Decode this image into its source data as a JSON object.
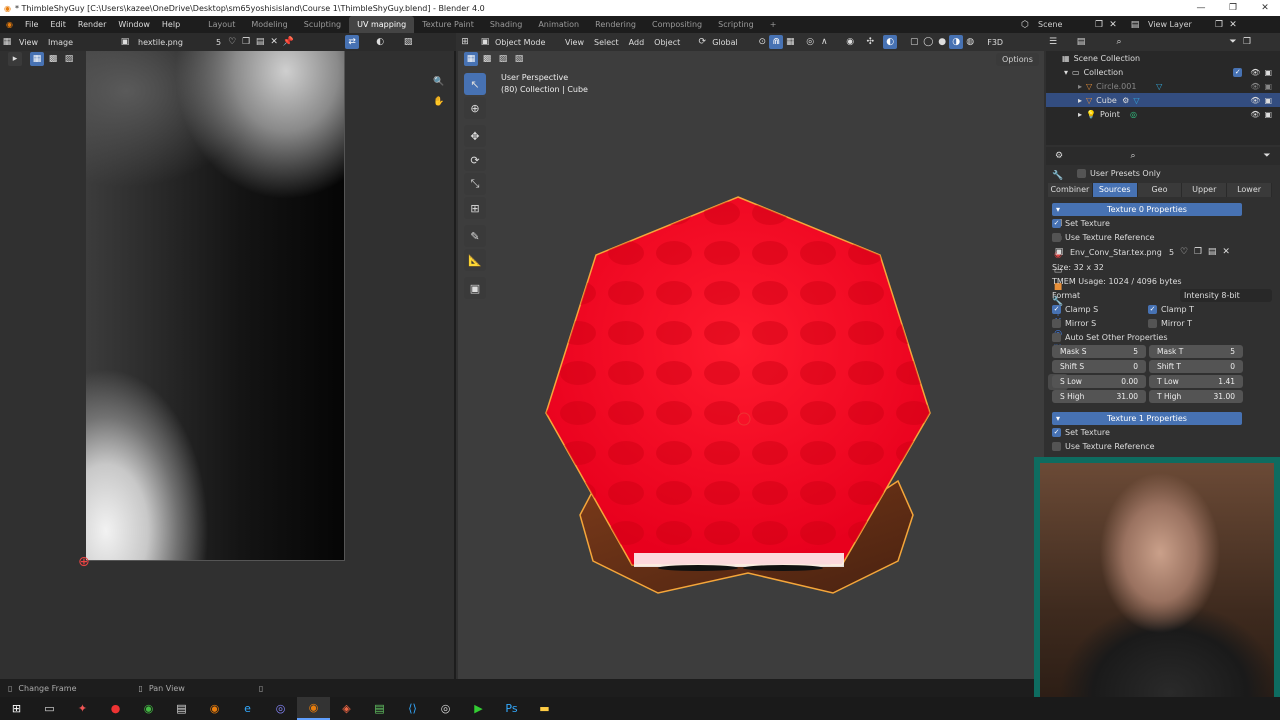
{
  "window": {
    "title": "* ThimbleShyGuy [C:\\Users\\kazee\\OneDrive\\Desktop\\sm65yoshisisland\\Course 1\\ThimbleShyGuy.blend] - Blender 4.0"
  },
  "menu": {
    "items": [
      "File",
      "Edit",
      "Render",
      "Window",
      "Help"
    ]
  },
  "workspaces": [
    "Layout",
    "Modeling",
    "Sculpting",
    "UV mapping",
    "Texture Paint",
    "Shading",
    "Animation",
    "Rendering",
    "Compositing",
    "Scripting",
    "+"
  ],
  "scene": {
    "name": "Scene",
    "view_layer": "View Layer"
  },
  "image_editor": {
    "view": "View",
    "image": "Image",
    "file": "hextile.png",
    "users": "5"
  },
  "viewport": {
    "mode": "Object Mode",
    "menus": [
      "View",
      "Select",
      "Add",
      "Object"
    ],
    "orientation": "Global",
    "options": "Options",
    "perspective": "User Perspective",
    "collection_line": "(80) Collection | Cube",
    "fsd": "F3D",
    "colors": {
      "accent": "#4772b3",
      "object": "#e8001d",
      "outline": "#f5a63a"
    }
  },
  "outliner": {
    "root": "Scene Collection",
    "collection": "Collection",
    "items": [
      "Circle.001",
      "Cube",
      "Point"
    ]
  },
  "props": {
    "user_presets": "User Presets Only",
    "tabs": [
      "Combiner",
      "Sources",
      "Geo",
      "Upper",
      "Lower"
    ],
    "tex0": "Texture 0 Properties",
    "set_texture": "Set Texture",
    "use_ref": "Use Texture Reference",
    "image": "Env_Conv_Star.tex.png",
    "image_users": "5",
    "size": "Size: 32 x 32",
    "tmem": "TMEM Usage: 1024 / 4096 bytes",
    "format_label": "Format",
    "format_val": "Intensity 8-bit",
    "clamp_s": "Clamp S",
    "clamp_t": "Clamp T",
    "mirror_s": "Mirror S",
    "mirror_t": "Mirror T",
    "auto_set": "Auto Set Other Properties",
    "fields": [
      {
        "l": "Mask S",
        "v": "5"
      },
      {
        "l": "Mask T",
        "v": "5"
      },
      {
        "l": "Shift S",
        "v": "0"
      },
      {
        "l": "Shift T",
        "v": "0"
      },
      {
        "l": "S Low",
        "v": "0.00"
      },
      {
        "l": "T Low",
        "v": "1.41"
      },
      {
        "l": "S High",
        "v": "31.00"
      },
      {
        "l": "T High",
        "v": "31.00"
      }
    ],
    "tex1": "Texture 1 Properties"
  },
  "status": {
    "left": "Change Frame",
    "mid": "Pan View"
  }
}
